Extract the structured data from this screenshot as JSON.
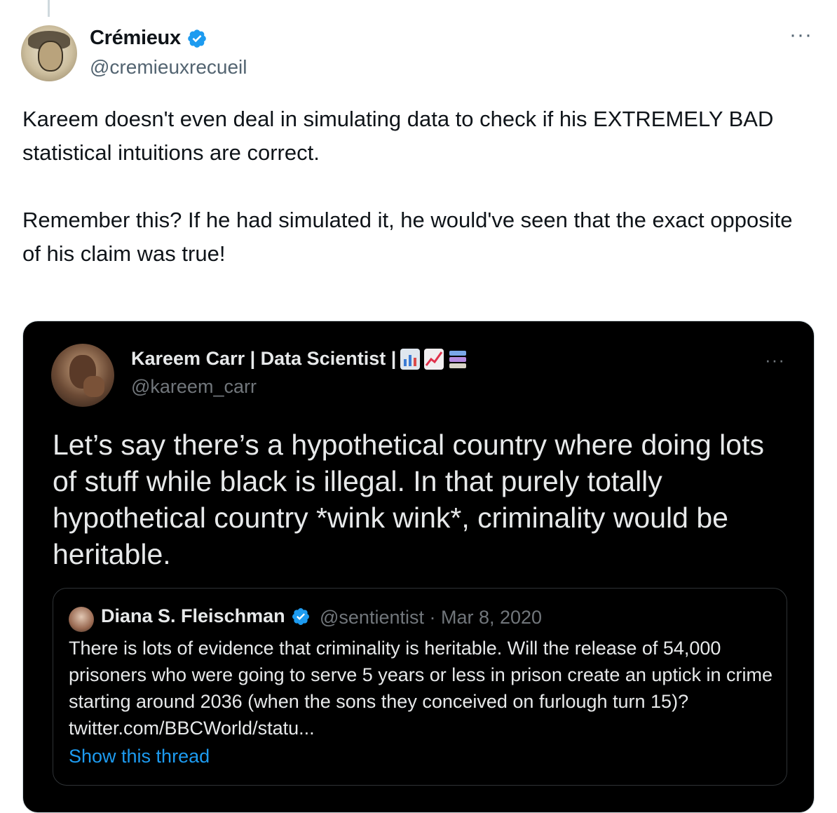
{
  "tweet": {
    "display_name": "Crémieux",
    "handle": "@cremieuxrecueil",
    "more_label": "···",
    "paragraphs": [
      "Kareem doesn't even deal in simulating data to check if his EXTREMELY BAD statistical intuitions are correct.",
      "Remember this? If he had simulated it, he would've seen that the exact opposite of his claim was true!"
    ]
  },
  "embedded": {
    "display_name": "Kareem Carr | Data Scientist |",
    "emojis": [
      "bar-chart-emoji",
      "chart-increasing-emoji",
      "books-emoji"
    ],
    "handle": "@kareem_carr",
    "more_label": "···",
    "text": "Let’s say there’s a hypothetical country where doing lots of stuff while black is illegal. In that purely totally hypothetical country *wink wink*, criminality would be heritable.",
    "quoted": {
      "display_name": "Diana S. Fleischman",
      "meta": "@sentientist · Mar 8, 2020",
      "text": "There is lots of evidence that criminality is heritable. Will the release of 54,000 prisoners who were going to serve 5 years or less in prison create an uptick in crime starting around 2036 (when the sons they conceived on furlough turn 15)? twitter.com/BBCWorld/statu...",
      "show_thread": "Show this thread"
    }
  },
  "colors": {
    "verified_blue": "#1d9bf0",
    "link_blue": "#1d9bf0",
    "card_background": "#000000"
  }
}
